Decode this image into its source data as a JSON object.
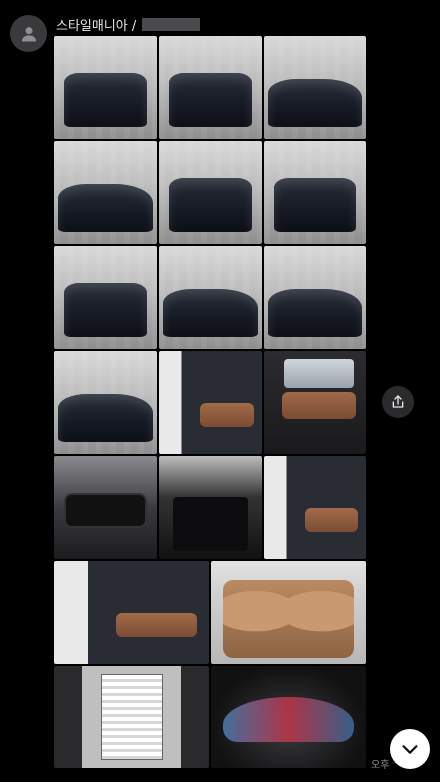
{
  "message": {
    "sender_name": "스타일매니아 /",
    "time": "오후"
  },
  "icons": {
    "avatar": "person-icon",
    "share": "share-icon",
    "scroll": "chevron-down-icon"
  },
  "colors": {
    "background": "#000000",
    "avatar_bg": "#3a3a3c",
    "share_bg": "#2b2b2d",
    "scroll_bg": "#ffffff",
    "time_text": "#8e8e93"
  }
}
